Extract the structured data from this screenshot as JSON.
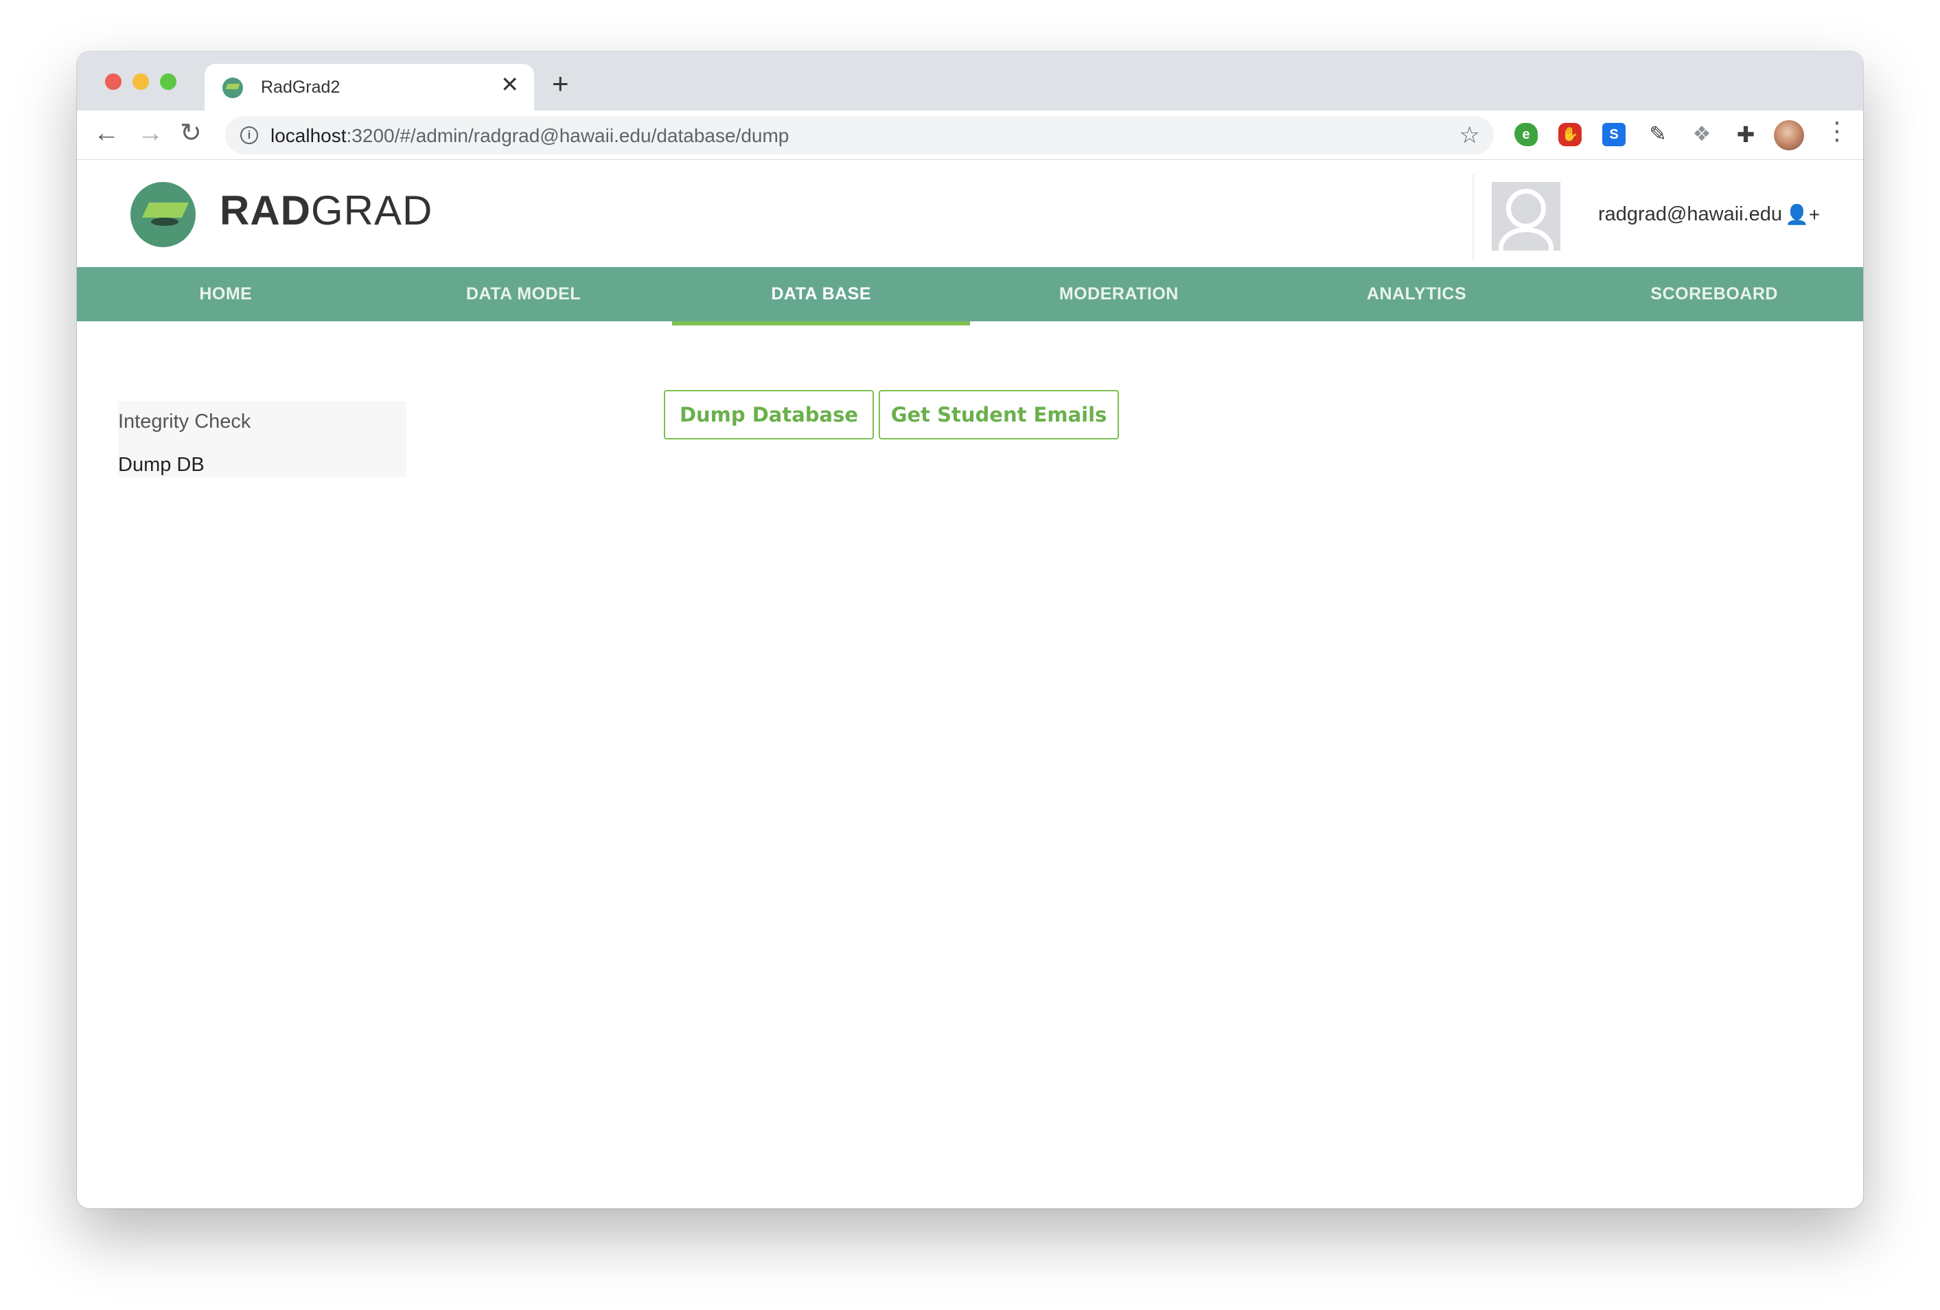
{
  "browser": {
    "tab_title": "RadGrad2",
    "tab_close": "✕",
    "new_tab": "+",
    "url_host": "localhost",
    "url_rest": ":3200/#/admin/radgrad@hawaii.edu/database/dump",
    "icons": {
      "back": "arrow-left-icon",
      "forward": "arrow-right-icon",
      "reload": "reload-icon",
      "info": "info-icon",
      "bookmark": "star-icon",
      "extensions": [
        "evernote-icon",
        "stop-icon",
        "s-icon",
        "eyedropper-icon",
        "dropbox-icon",
        "puzzle-icon"
      ],
      "menu": "kebab-menu-icon"
    }
  },
  "header": {
    "brand_bold": "RAD",
    "brand_light": "GRAD",
    "user_email": "radgrad@hawaii.edu",
    "colors": {
      "primary": "#66a88f",
      "accent": "#7dc04f"
    }
  },
  "nav": {
    "items": [
      {
        "label": "HOME"
      },
      {
        "label": "DATA MODEL"
      },
      {
        "label": "DATA BASE",
        "active": true
      },
      {
        "label": "MODERATION"
      },
      {
        "label": "ANALYTICS"
      },
      {
        "label": "SCOREBOARD"
      }
    ]
  },
  "sidebar": {
    "items": [
      {
        "label": "Integrity Check"
      },
      {
        "label": "Dump DB",
        "active": true
      }
    ]
  },
  "actions": {
    "dump_label": "Dump Database",
    "emails_label": "Get Student Emails"
  }
}
